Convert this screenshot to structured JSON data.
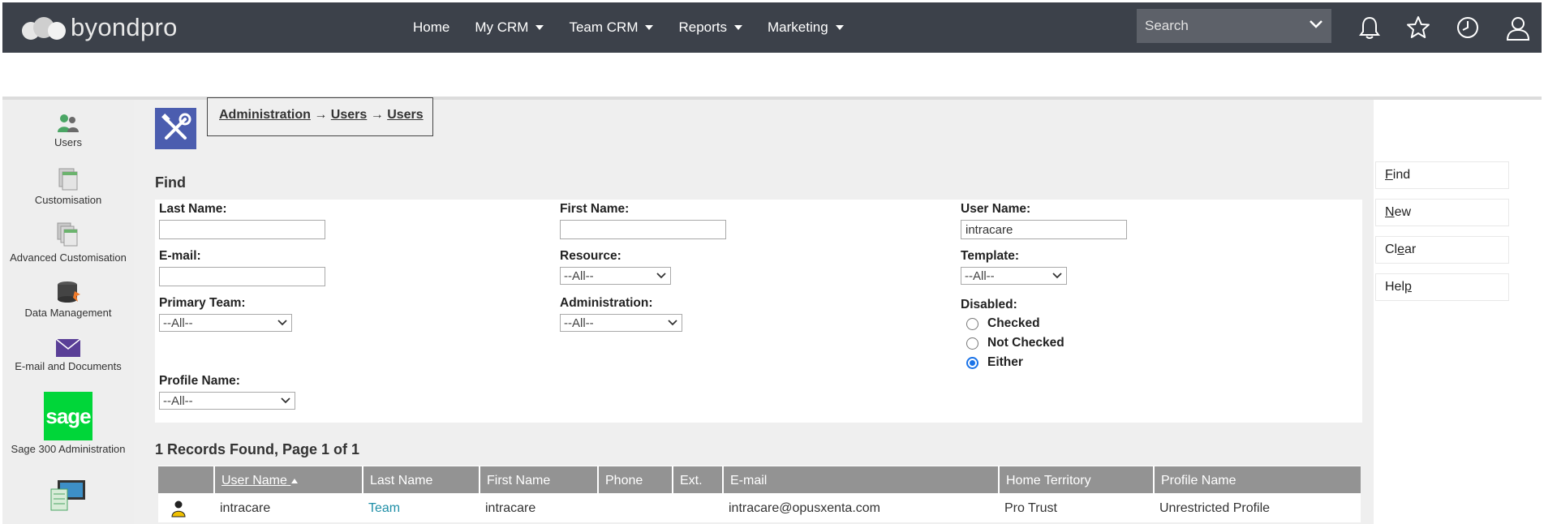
{
  "brand": {
    "name": "byondpro"
  },
  "nav": {
    "items": [
      {
        "label": "Home",
        "dropdown": false
      },
      {
        "label": "My CRM",
        "dropdown": true
      },
      {
        "label": "Team CRM",
        "dropdown": true
      },
      {
        "label": "Reports",
        "dropdown": true
      },
      {
        "label": "Marketing",
        "dropdown": true
      }
    ],
    "search_placeholder": "Search"
  },
  "sidebar": {
    "items": [
      {
        "label": "Users",
        "icon": "users-icon"
      },
      {
        "label": "Customisation",
        "icon": "customisation-icon"
      },
      {
        "label": "Advanced Customisation",
        "icon": "advanced-customisation-icon"
      },
      {
        "label": "Data Management",
        "icon": "data-management-icon"
      },
      {
        "label": "E-mail and Documents",
        "icon": "email-icon"
      },
      {
        "label": "Sage 300 Administration",
        "icon": "sage-logo",
        "logo_text": "sage"
      },
      {
        "label": "",
        "icon": "system-icon"
      }
    ]
  },
  "breadcrumb": {
    "parts": [
      "Administration",
      "Users",
      "Users"
    ],
    "separator": "→"
  },
  "find": {
    "title": "Find",
    "last_name": {
      "label": "Last Name:",
      "value": ""
    },
    "first_name": {
      "label": "First Name:",
      "value": ""
    },
    "user_name": {
      "label": "User Name:",
      "value": "intracare"
    },
    "email": {
      "label": "E-mail:",
      "value": ""
    },
    "resource": {
      "label": "Resource:",
      "selected": "--All--"
    },
    "template": {
      "label": "Template:",
      "selected": "--All--"
    },
    "primary_team": {
      "label": "Primary Team:",
      "selected": "--All--"
    },
    "administration": {
      "label": "Administration:",
      "selected": "--All--"
    },
    "disabled": {
      "label": "Disabled:",
      "options": [
        "Checked",
        "Not Checked",
        "Either"
      ],
      "selected": "Either"
    },
    "profile_name": {
      "label": "Profile Name:",
      "selected": "--All--"
    }
  },
  "results": {
    "summary": "1 Records Found, Page 1 of 1",
    "columns": [
      "",
      "User Name",
      "Last Name",
      "First Name",
      "Phone",
      "Ext.",
      "E-mail",
      "Home Territory",
      "Profile Name"
    ],
    "sorted_column": "User Name",
    "rows": [
      {
        "user_name": "intracare",
        "last_name": "Team",
        "first_name": "intracare",
        "phone": "",
        "ext": "",
        "email": "intracare@opusxenta.com",
        "home_territory": "Pro Trust",
        "profile_name": "Unrestricted Profile"
      }
    ]
  },
  "actions": [
    {
      "label": "Find",
      "access_key": "F",
      "rest": "ind"
    },
    {
      "label": "New",
      "access_key": "N",
      "rest": "ew"
    },
    {
      "label": "Clear",
      "access_key": "",
      "pre": "Cl",
      "ul": "e",
      "post": "ar"
    },
    {
      "label": "Help",
      "access_key": "",
      "pre": "Hel",
      "ul": "p",
      "post": ""
    }
  ],
  "colors": {
    "topbar": "#3c414a",
    "accent": "#4b5daf",
    "sage_green": "#00d639",
    "link": "#1f8fa7",
    "grid_header": "#939393"
  }
}
